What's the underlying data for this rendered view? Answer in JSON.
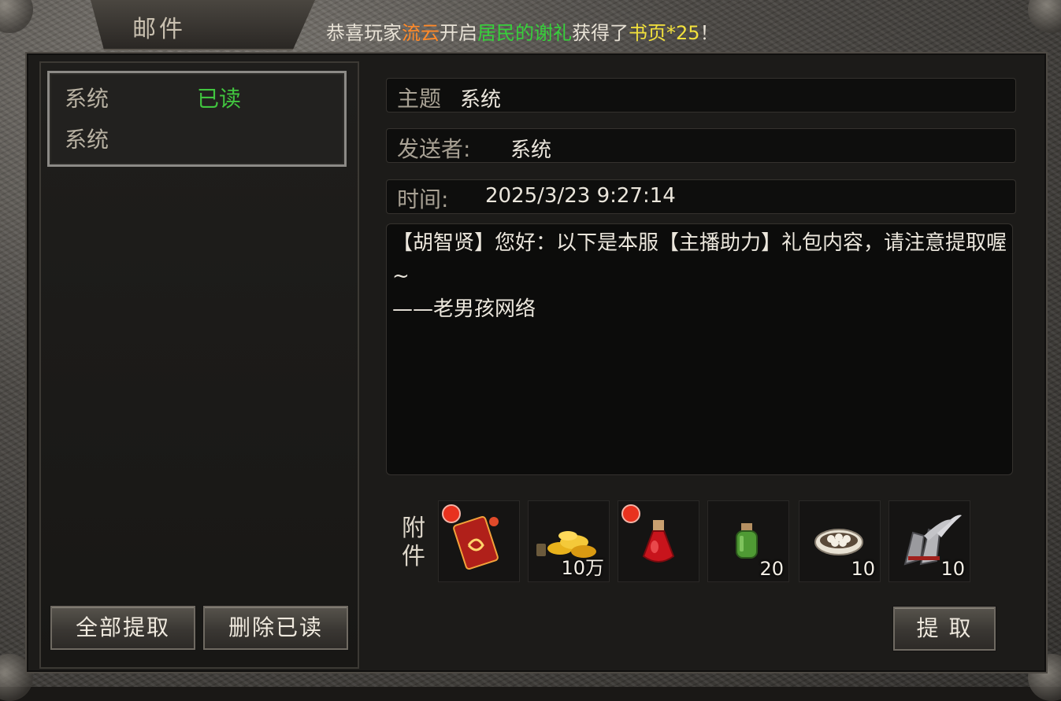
{
  "window": {
    "title": "邮件"
  },
  "announcement": {
    "prefix": "恭喜玩家",
    "player": "流云",
    "middle": "开启",
    "event": "居民的谢礼",
    "obtained": "获得了",
    "reward": "书页*25",
    "suffix": "！"
  },
  "mail_list": [
    {
      "sender": "系统",
      "status": "已读",
      "subject": "系统"
    }
  ],
  "buttons": {
    "claim_all": "全部提取",
    "delete_read": "删除已读",
    "claim": "提 取"
  },
  "detail": {
    "subject_label": "主题",
    "subject_value": "系统",
    "sender_label": "发送者:",
    "sender_value": "系统",
    "time_label": "时间:",
    "time_value": "2025/3/23 9:27:14",
    "body_line1": "【胡智贤】您好：以下是本服【主播助力】礼包内容，请注意提取喔~",
    "body_line2": "——老男孩网络"
  },
  "attachments": {
    "label": "附件",
    "items": [
      {
        "icon": "red-scroll-icon",
        "qty": "",
        "new": true
      },
      {
        "icon": "gold-coins-icon",
        "qty": "10万",
        "new": false
      },
      {
        "icon": "red-potion-icon",
        "qty": "",
        "new": true
      },
      {
        "icon": "green-potion-icon",
        "qty": "20",
        "new": false
      },
      {
        "icon": "egg-bowl-icon",
        "qty": "10",
        "new": false
      },
      {
        "icon": "winged-boots-icon",
        "qty": "10",
        "new": false
      }
    ]
  },
  "colors": {
    "player_name": "#ff8a2a",
    "event_name": "#37d03b",
    "reward": "#f2e13c",
    "read_status": "#41c53f"
  }
}
